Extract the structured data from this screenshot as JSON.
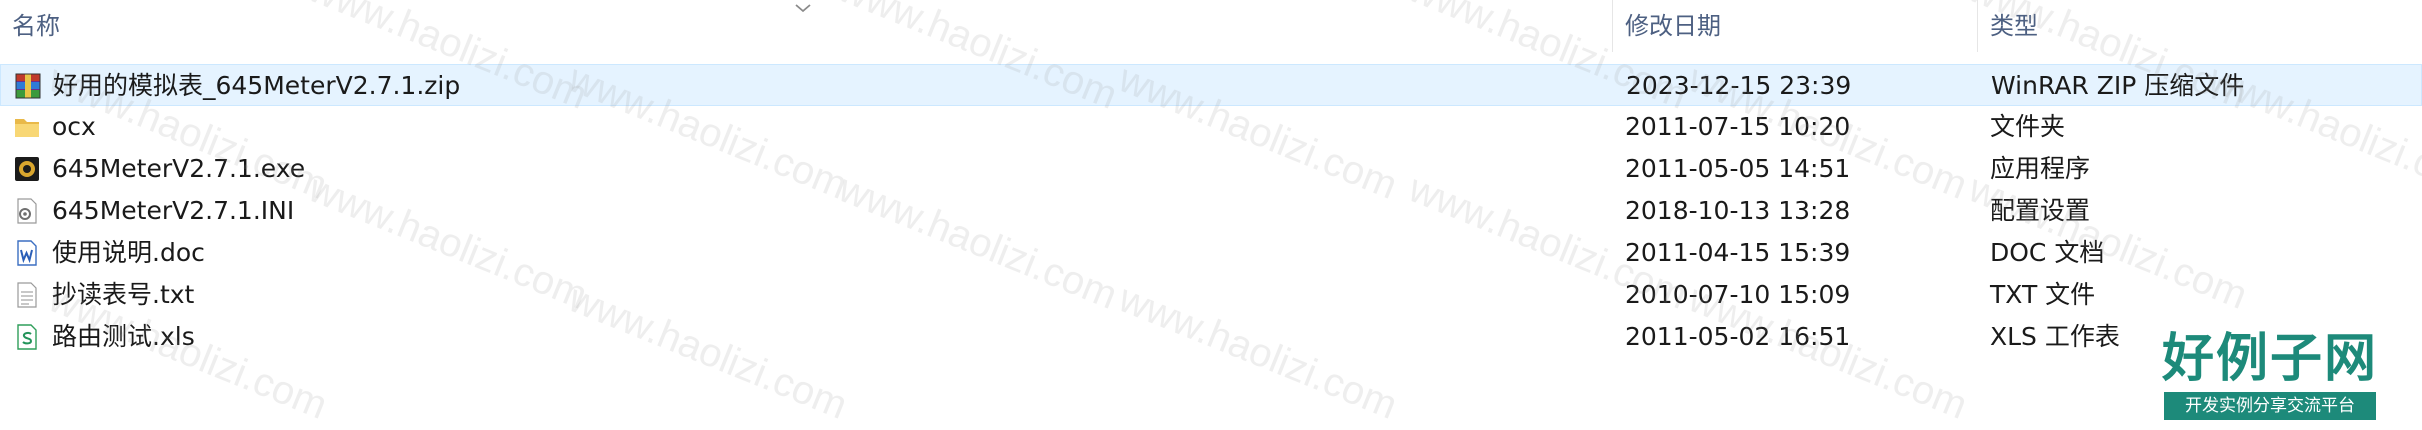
{
  "columns": {
    "name": "名称",
    "date_modified": "修改日期",
    "type": "类型"
  },
  "files": [
    {
      "name": "好用的模拟表_645MeterV2.7.1.zip",
      "date": "2023-12-15 23:39",
      "type": "WinRAR ZIP 压缩文件",
      "icon": "winrar-archive-icon"
    },
    {
      "name": "ocx",
      "date": "2011-07-15 10:20",
      "type": "文件夹",
      "icon": "folder-icon"
    },
    {
      "name": "645MeterV2.7.1.exe",
      "date": "2011-05-05 14:51",
      "type": "应用程序",
      "icon": "application-icon"
    },
    {
      "name": "645MeterV2.7.1.INI",
      "date": "2018-10-13 13:28",
      "type": "配置设置",
      "icon": "settings-file-icon"
    },
    {
      "name": "使用说明.doc",
      "date": "2011-04-15 15:39",
      "type": "DOC 文档",
      "icon": "word-document-icon"
    },
    {
      "name": "抄读表号.txt",
      "date": "2010-07-10 15:09",
      "type": "TXT 文件",
      "icon": "text-file-icon"
    },
    {
      "name": "路由测试.xls",
      "date": "2011-05-02 16:51",
      "type": "XLS 工作表",
      "icon": "spreadsheet-icon"
    }
  ],
  "watermark": {
    "text": "www.haolizi.com",
    "logo_main": "好例子网",
    "logo_sub": "开发实例分享交流平台"
  },
  "colors": {
    "header_text": "#4d6082",
    "selection_bg": "#e5f3ff",
    "selection_border": "#cce8ff",
    "logo_green": "#1d8a7a"
  }
}
